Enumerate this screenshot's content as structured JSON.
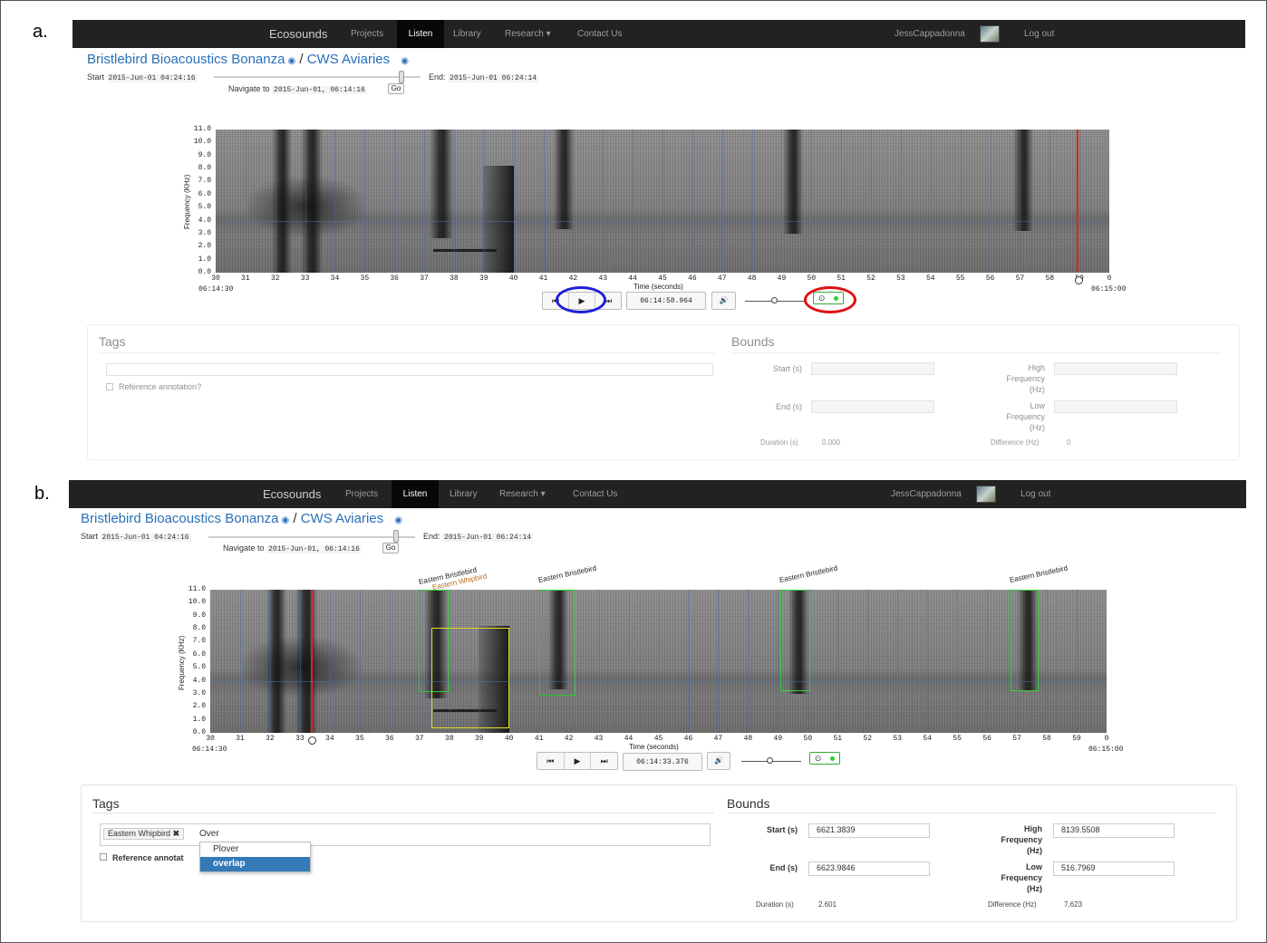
{
  "panel_labels": {
    "a": "a.",
    "b": "b."
  },
  "nav": {
    "brand": "Ecosounds",
    "items": [
      "Projects",
      "Listen",
      "Library",
      "Research ▾",
      "Contact Us"
    ],
    "active": "Listen",
    "user": "JessCappadonna",
    "logout": "Log out"
  },
  "breadcrumb": {
    "project": "Bristlebird Bioacoustics Bonanza",
    "separator": "/",
    "site": "CWS Aviaries",
    "eye_icon": "◉"
  },
  "range": {
    "start_label": "Start",
    "start_value": "2015-Jun-01 04:24:16",
    "end_label": "End:",
    "end_value": "2015-Jun-01 06:24:14",
    "navigate_label": "Navigate to",
    "navigate_value": "2015-Jun-01, 06:14:16",
    "go_label": "Go"
  },
  "spectrogram": {
    "y_axis_title": "Frequency (KHz)",
    "x_axis_title": "Time (seconds)",
    "y_ticks": [
      "11.0",
      "10.0",
      "9.0",
      "8.0",
      "7.0",
      "6.0",
      "5.0",
      "4.0",
      "3.0",
      "2.0",
      "1.0",
      "0.0"
    ],
    "x_ticks": [
      "30",
      "31",
      "32",
      "33",
      "34",
      "35",
      "36",
      "37",
      "38",
      "39",
      "40",
      "41",
      "42",
      "43",
      "44",
      "45",
      "46",
      "47",
      "48",
      "49",
      "50",
      "51",
      "52",
      "53",
      "54",
      "55",
      "56",
      "57",
      "58",
      "59",
      "0"
    ],
    "start_time": "06:14:30",
    "end_time": "06:15:00"
  },
  "controls": {
    "prev_icon": "⏮",
    "play_icon": "▶",
    "next_icon": "⏭",
    "volume_icon": "🔊",
    "annotation_toggle_icon": "⊙",
    "position_a": "06:14:58.964",
    "position_b": "06:14:33.376",
    "highlight_play_color": "#1f1fd6",
    "highlight_toggle_color": "#e01010"
  },
  "annotations_b": [
    {
      "label": "Eastern Bristlebird"
    },
    {
      "label": "Eastern Whipbird"
    },
    {
      "label": "Eastern Bristlebird"
    },
    {
      "label": "Eastern Bristlebird"
    },
    {
      "label": "Eastern Bristlebird"
    }
  ],
  "form": {
    "tags_title": "Tags",
    "bounds_title": "Bounds",
    "reference_label": "Reference annotation?",
    "reference_label_b": "Reference annotat",
    "start_label": "Start (s)",
    "end_label": "End (s)",
    "high_freq_label": "High\nFrequency\n(Hz)",
    "low_freq_label": "Low\nFrequency\n(Hz)",
    "duration_label": "Duration (s)",
    "difference_label": "Difference (Hz)",
    "a": {
      "duration_value": "0.000",
      "difference_value": "0"
    },
    "b": {
      "tag_chip": "Eastern Whipbird",
      "tag_chip_remove": "✖",
      "tag_input": "Over",
      "suggestions": [
        "Plover",
        "overlap"
      ],
      "selected_suggestion": "overlap",
      "start_value": "6621.3839",
      "end_value": "6623.9846",
      "high_freq_value": "8139.5508",
      "low_freq_value": "516.7969",
      "duration_value": "2.601",
      "difference_value": "7,623"
    }
  }
}
